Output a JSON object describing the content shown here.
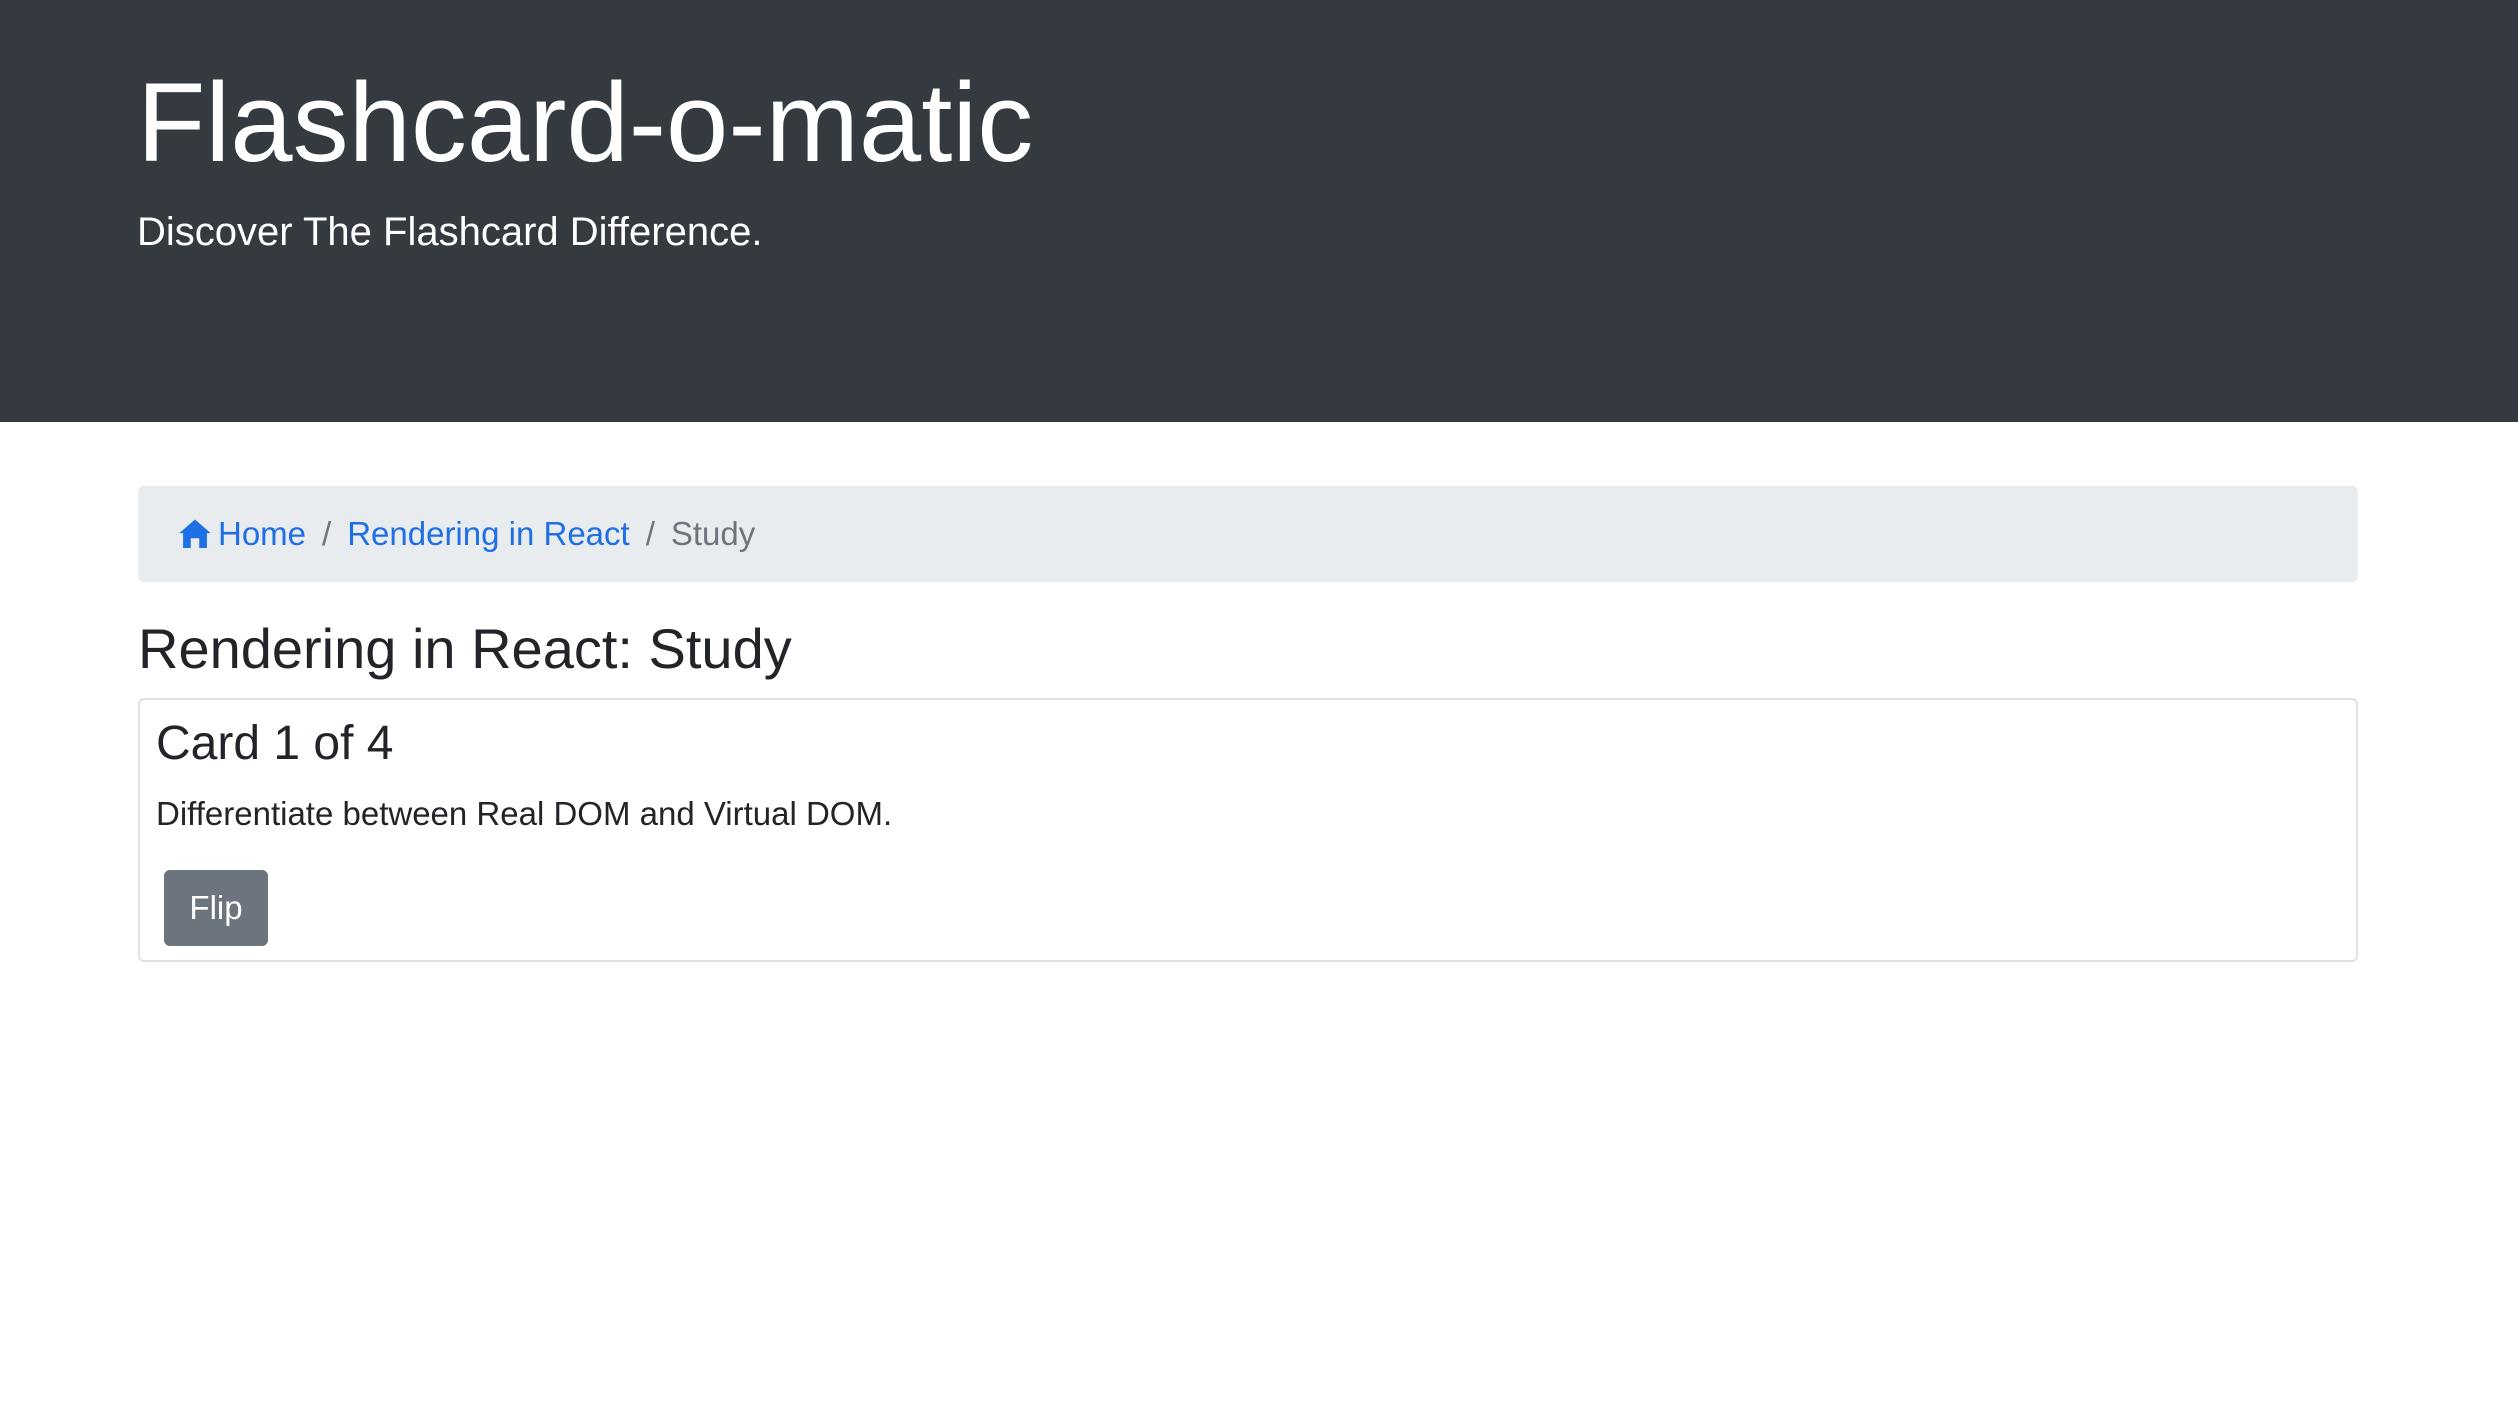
{
  "header": {
    "title": "Flashcard-o-matic",
    "tagline": "Discover The Flashcard Difference."
  },
  "breadcrumb": {
    "home_icon": "home-icon",
    "home_label": "Home",
    "deck_label": "Rendering in React",
    "current_label": "Study",
    "separator": "/"
  },
  "page": {
    "title": "Rendering in React: Study"
  },
  "card": {
    "title": "Card 1 of 4",
    "front_text": "Differentiate between Real DOM and Virtual DOM.",
    "flip_label": "Flip"
  },
  "colors": {
    "header_bg": "#343a40",
    "link": "#1f6fe5",
    "breadcrumb_bg": "#e9ecef",
    "button_bg": "#6c757d"
  }
}
